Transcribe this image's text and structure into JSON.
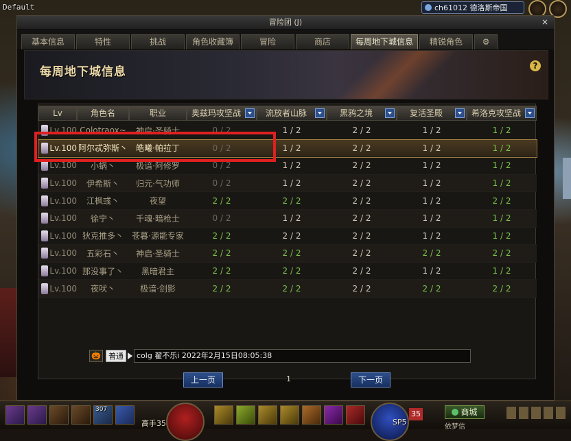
{
  "top": {
    "default_label": "Default",
    "server_text": "ch61012 德洛斯帝国"
  },
  "window": {
    "title": "冒险团 (J)",
    "close": "×"
  },
  "tabs": [
    {
      "label": "基本信息",
      "active": false
    },
    {
      "label": "特性",
      "active": false
    },
    {
      "label": "挑战",
      "active": false
    },
    {
      "label": "角色收藏簿",
      "active": false
    },
    {
      "label": "冒险",
      "active": false
    },
    {
      "label": "商店",
      "active": false
    },
    {
      "label": "每周地下城信息",
      "active": true
    },
    {
      "label": "精锐角色",
      "active": false
    },
    {
      "label": "⚙",
      "active": false
    }
  ],
  "banner": {
    "title": "每周地下城信息",
    "help": "?"
  },
  "table": {
    "headers": {
      "lv": "Lv",
      "name": "角色名",
      "job": "职业",
      "d1": "奥兹玛攻坚战",
      "d2": "流放者山脉",
      "d3": "黑鸦之境",
      "d4": "复活圣殿",
      "d5": "希洛克攻坚战"
    },
    "rows": [
      {
        "lv": "Lv.100",
        "name": "Colotraox~",
        "job": "神启·圣骑士",
        "d1": "0 / 2",
        "d2": "1 / 2",
        "d3": "2 / 2",
        "d4": "1 / 2",
        "d5": "1 / 2",
        "c1": "grey",
        "c2": "white",
        "c3": "white",
        "c4": "white",
        "c5": "green"
      },
      {
        "lv": "Lv.100",
        "name": "阿尔忒弥斯丶",
        "job": "皓曦·帕拉丁",
        "d1": "0 / 2",
        "d2": "1 / 2",
        "d3": "2 / 2",
        "d4": "1 / 2",
        "d5": "1 / 2",
        "c1": "grey",
        "c2": "white",
        "c3": "white",
        "c4": "white",
        "c5": "green"
      },
      {
        "lv": "Lv.100",
        "name": "小蜗丶",
        "job": "极谙·阿修罗",
        "d1": "0 / 2",
        "d2": "1 / 2",
        "d3": "2 / 2",
        "d4": "1 / 2",
        "d5": "1 / 2",
        "c1": "grey",
        "c2": "white",
        "c3": "white",
        "c4": "white",
        "c5": "green"
      },
      {
        "lv": "Lv.100",
        "name": "伊希斯丶",
        "job": "归元·气功师",
        "d1": "0 / 2",
        "d2": "1 / 2",
        "d3": "2 / 2",
        "d4": "1 / 2",
        "d5": "1 / 2",
        "c1": "grey",
        "c2": "white",
        "c3": "white",
        "c4": "white",
        "c5": "green"
      },
      {
        "lv": "Lv.100",
        "name": "江枫彧丶",
        "job": "夜望",
        "d1": "2 / 2",
        "d2": "2 / 2",
        "d3": "2 / 2",
        "d4": "1 / 2",
        "d5": "2 / 2",
        "c1": "green",
        "c2": "green",
        "c3": "white",
        "c4": "white",
        "c5": "green"
      },
      {
        "lv": "Lv.100",
        "name": "徐宁丶",
        "job": "千魂·暗枪士",
        "d1": "0 / 2",
        "d2": "1 / 2",
        "d3": "2 / 2",
        "d4": "1 / 2",
        "d5": "1 / 2",
        "c1": "grey",
        "c2": "white",
        "c3": "white",
        "c4": "white",
        "c5": "green"
      },
      {
        "lv": "Lv.100",
        "name": "狄克推多丶",
        "job": "苍暮·源能专家",
        "d1": "2 / 2",
        "d2": "2 / 2",
        "d3": "2 / 2",
        "d4": "1 / 2",
        "d5": "1 / 2",
        "c1": "green",
        "c2": "white",
        "c3": "white",
        "c4": "white",
        "c5": "green"
      },
      {
        "lv": "Lv.100",
        "name": "五彩石丶",
        "job": "神启·圣骑士",
        "d1": "2 / 2",
        "d2": "2 / 2",
        "d3": "2 / 2",
        "d4": "2 / 2",
        "d5": "2 / 2",
        "c1": "green",
        "c2": "green",
        "c3": "white",
        "c4": "green",
        "c5": "green"
      },
      {
        "lv": "Lv.100",
        "name": "那没事了丶",
        "job": "黑暗君主",
        "d1": "2 / 2",
        "d2": "2 / 2",
        "d3": "2 / 2",
        "d4": "1 / 2",
        "d5": "1 / 2",
        "c1": "green",
        "c2": "green",
        "c3": "white",
        "c4": "white",
        "c5": "green"
      },
      {
        "lv": "Lv.100",
        "name": "夜吠丶",
        "job": "极谙·剑影",
        "d1": "2 / 2",
        "d2": "2 / 2",
        "d3": "2 / 2",
        "d4": "2 / 2",
        "d5": "2 / 2",
        "c1": "green",
        "c2": "green",
        "c3": "white",
        "c4": "green",
        "c5": "green"
      }
    ]
  },
  "chat": {
    "icon": "🎃",
    "channel": "普通",
    "text": "colg 翟不乐i 2022年2月15日08:05:38"
  },
  "pager": {
    "prev": "上一页",
    "page": "1",
    "next": "下一页"
  },
  "hud": {
    "level_text": "高手35",
    "sp_text": "SP5",
    "level_badge": "35",
    "shop_label": "商城",
    "sub_label": "依梦信",
    "skill_count": "307"
  }
}
